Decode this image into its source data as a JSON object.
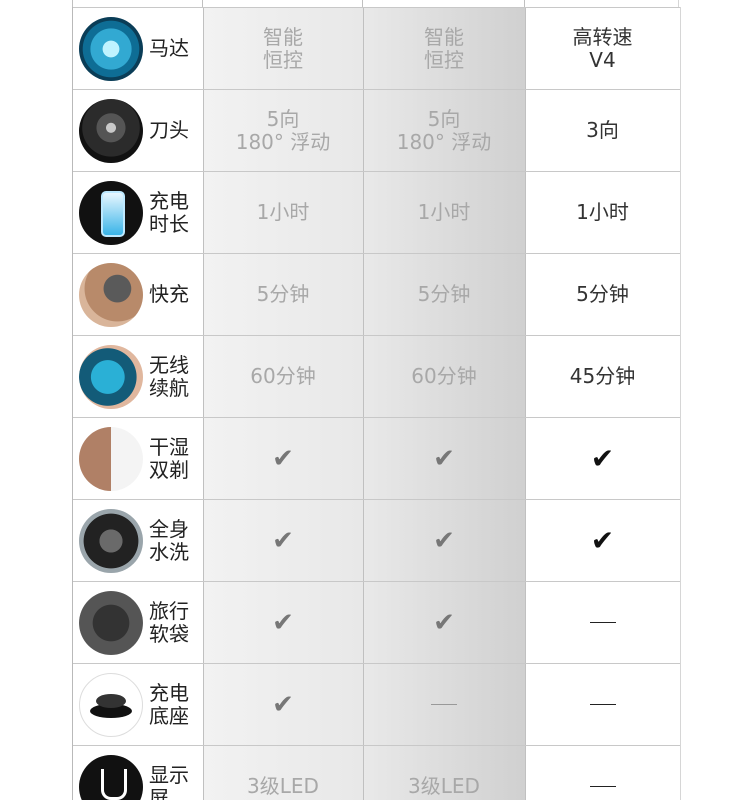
{
  "rows": [
    {
      "icon": "motor-icon",
      "label": "马达",
      "c1": "智能\n恒控",
      "c2": "智能\n恒控",
      "c3": "高转速\nV4"
    },
    {
      "icon": "blade-head-icon",
      "label": "刀头",
      "c1": "5向\n180° 浮动",
      "c2": "5向\n180° 浮动",
      "c3": "3向"
    },
    {
      "icon": "battery-icon",
      "label": "充电\n时长",
      "c1": "1小时",
      "c2": "1小时",
      "c3": "1小时"
    },
    {
      "icon": "fast-charge-icon",
      "label": "快充",
      "c1": "5分钟",
      "c2": "5分钟",
      "c3": "5分钟"
    },
    {
      "icon": "wireless-icon",
      "label": "无线\n续航",
      "c1": "60分钟",
      "c2": "60分钟",
      "c3": "45分钟"
    },
    {
      "icon": "wet-dry-icon",
      "label": "干湿\n双剃",
      "c1": "check",
      "c2": "check",
      "c3": "check"
    },
    {
      "icon": "full-wash-icon",
      "label": "全身\n水洗",
      "c1": "check",
      "c2": "check",
      "c3": "check"
    },
    {
      "icon": "travel-pouch-icon",
      "label": "旅行\n软袋",
      "c1": "check",
      "c2": "check",
      "c3": "dash"
    },
    {
      "icon": "charging-stand-icon",
      "label": "充电\n底座",
      "c1": "check",
      "c2": "dash",
      "c3": "dash"
    },
    {
      "icon": "display-icon",
      "label": "显示\n屏",
      "c1": "3级LED",
      "c2": "3级LED",
      "c3": "dash"
    }
  ],
  "symbols": {
    "check": "✔"
  }
}
